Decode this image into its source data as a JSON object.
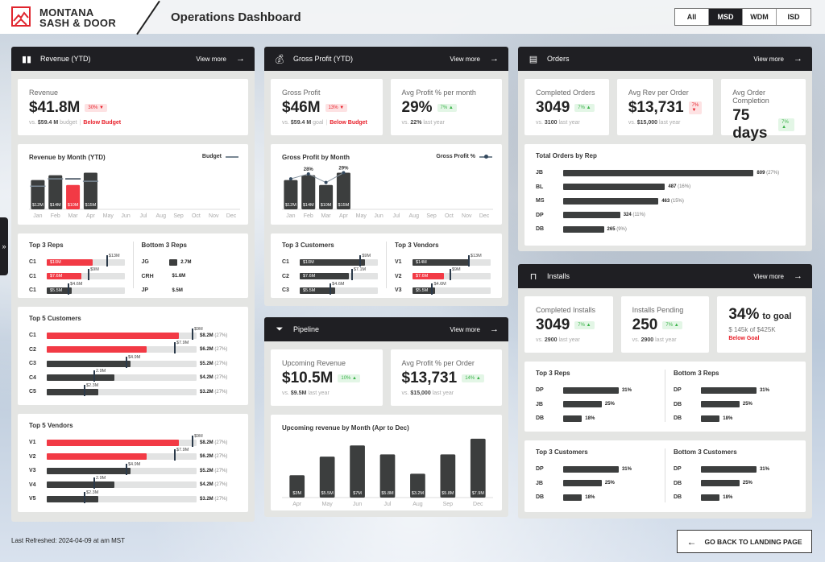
{
  "header": {
    "brand_line1": "MONTANA",
    "brand_line2": "SASH & DOOR",
    "title": "Operations Dashboard",
    "filters": [
      {
        "label": "All",
        "active": false
      },
      {
        "label": "MSD",
        "active": true
      },
      {
        "label": "WDM",
        "active": false
      },
      {
        "label": "ISD",
        "active": false
      }
    ]
  },
  "colors": {
    "accent": "#f23a45",
    "bar": "#3c3e3e",
    "panel_header": "#1f1f23",
    "up": "#3cb44b",
    "down": "#e8202a",
    "target": "#2b3a4a"
  },
  "revenue": {
    "title": "Revenue (YTD)",
    "view_more": "View more",
    "kpi": {
      "label": "Revenue",
      "value": "$41.8M",
      "delta": "30%",
      "dir": "down",
      "vs_prefix": "vs.",
      "vs_value": "$59.4 M",
      "vs_suffix": "budget",
      "status": "Below Budget"
    },
    "chart": {
      "title": "Revenue by Month (YTD)",
      "legend": "Budget",
      "type": "bar",
      "categories": [
        "Jan",
        "Feb",
        "Mar",
        "Apr",
        "May",
        "Jun",
        "Jul",
        "Aug",
        "Sep",
        "Oct",
        "Nov",
        "Dec"
      ],
      "values": [
        12,
        14,
        10,
        15
      ],
      "value_labels": [
        "$12M",
        "$14M",
        "$10M",
        "$15M"
      ],
      "budget": [
        9.5,
        12.5,
        12.5,
        11.5
      ],
      "highlight": [
        false,
        false,
        true,
        false
      ],
      "ylim": [
        0,
        16.5
      ]
    },
    "top_reps": {
      "title": "Top 3 Reps",
      "max": 17,
      "rows": [
        {
          "label": "C1",
          "value": 10,
          "value_label": "$10M",
          "target": 13,
          "target_label": "$13M",
          "highlight": true
        },
        {
          "label": "C1",
          "value": 7.6,
          "value_label": "$7.6M",
          "target": 9,
          "target_label": "$9M",
          "highlight": true
        },
        {
          "label": "C1",
          "value": 5.5,
          "value_label": "$5.5M",
          "target": 4.6,
          "target_label": "$4.6M",
          "highlight": false
        }
      ]
    },
    "bottom_reps": {
      "title": "Bottom 3 Reps",
      "max": 4.5,
      "rows": [
        {
          "label": "JG",
          "value": 2.7,
          "value_label": "2.7M"
        },
        {
          "label": "CRH",
          "value": 1.6,
          "value_label": "$1.6M"
        },
        {
          "label": "JP",
          "value": 0.5,
          "value_label": "$.5M"
        }
      ]
    },
    "top_customers": {
      "title": "Top 5 Customers",
      "max": 9.3,
      "rows": [
        {
          "label": "C1",
          "value": 8.2,
          "target": 9,
          "target_label": "$9M",
          "highlight": true,
          "total": "$8.2M",
          "pct": "(27%)"
        },
        {
          "label": "C2",
          "value": 6.2,
          "target": 7.9,
          "target_label": "$7.9M",
          "highlight": true,
          "total": "$6.2M",
          "pct": "(27%)"
        },
        {
          "label": "C3",
          "value": 5.2,
          "target": 4.9,
          "target_label": "$4.9M",
          "highlight": false,
          "total": "$5.2M",
          "pct": "(27%)"
        },
        {
          "label": "C4",
          "value": 4.2,
          "target": 2.9,
          "target_label": "2.9M",
          "highlight": false,
          "total": "$4.2M",
          "pct": "(27%)"
        },
        {
          "label": "C5",
          "value": 3.2,
          "target": 2.3,
          "target_label": "$2.3M",
          "highlight": false,
          "total": "$3.2M",
          "pct": "(27%)"
        }
      ]
    },
    "top_vendors": {
      "title": "Top 5 Vendors",
      "max": 9.3,
      "rows": [
        {
          "label": "V1",
          "value": 8.2,
          "target": 9,
          "target_label": "$9M",
          "highlight": true,
          "total": "$8.2M",
          "pct": "(27%)"
        },
        {
          "label": "V2",
          "value": 6.2,
          "target": 7.9,
          "target_label": "$7.9M",
          "highlight": true,
          "total": "$6.2M",
          "pct": "(27%)"
        },
        {
          "label": "V3",
          "value": 5.2,
          "target": 4.9,
          "target_label": "$4.9M",
          "highlight": false,
          "total": "$5.2M",
          "pct": "(27%)"
        },
        {
          "label": "V4",
          "value": 4.2,
          "target": 2.9,
          "target_label": "2.9M",
          "highlight": false,
          "total": "$4.2M",
          "pct": "(27%)"
        },
        {
          "label": "V5",
          "value": 3.2,
          "target": 2.3,
          "target_label": "$2.3M",
          "highlight": false,
          "total": "$3.2M",
          "pct": "(27%)"
        }
      ]
    }
  },
  "gross_profit": {
    "title": "Gross Profit (YTD)",
    "view_more": "View more",
    "kpi": {
      "label": "Gross Profit",
      "value": "$46M",
      "delta": "13%",
      "dir": "down",
      "vs_prefix": "vs.",
      "vs_value": "$59.4 M",
      "vs_suffix": "goal",
      "status": "Below Budget"
    },
    "kpi2": {
      "label": "Avg Profit % per month",
      "value": "29%",
      "delta": "7%",
      "dir": "up",
      "vs_prefix": "vs.",
      "vs_value": "22%",
      "vs_suffix": "last year"
    },
    "chart": {
      "title": "Gross Profit by Month",
      "legend": "Gross Profit %",
      "type": "bar",
      "categories": [
        "Jan",
        "Feb",
        "Mar",
        "Apr",
        "May",
        "Jun",
        "Jul",
        "Aug",
        "Sep",
        "Oct",
        "Nov",
        "Dec"
      ],
      "values": [
        12,
        14,
        10,
        15
      ],
      "value_labels": [
        "$12M",
        "$14M",
        "$10M",
        "$15M"
      ],
      "highlight": [
        false,
        false,
        false,
        false
      ],
      "line": [
        12.5,
        14.5,
        11,
        15
      ],
      "line_labels": [
        "",
        "28%",
        "",
        "29%"
      ],
      "ylim": [
        0,
        16.5
      ]
    },
    "top_customers": {
      "title": "Top 3 Customers",
      "max": 12,
      "rows": [
        {
          "label": "C1",
          "value": 10,
          "value_label": "$10M",
          "target": 9.2,
          "target_label": "$9M",
          "highlight": false
        },
        {
          "label": "C2",
          "value": 7.6,
          "value_label": "$7.6M",
          "target": 7.9,
          "target_label": "$7.1M",
          "highlight": false
        },
        {
          "label": "C3",
          "value": 5.5,
          "value_label": "$5.5M",
          "target": 4.6,
          "target_label": "$4.6M",
          "highlight": false
        }
      ]
    },
    "top_vendors": {
      "title": "Top 3 Vendors",
      "max": 19,
      "rows": [
        {
          "label": "V1",
          "value": 14,
          "value_label": "$14M",
          "target": 13.5,
          "target_label": "$13M",
          "highlight": false
        },
        {
          "label": "V2",
          "value": 7.6,
          "value_label": "$7.6M",
          "target": 9,
          "target_label": "$9M",
          "highlight": true
        },
        {
          "label": "V3",
          "value": 5.5,
          "value_label": "$5.5M",
          "target": 4.6,
          "target_label": "$4.6M",
          "highlight": false
        }
      ]
    }
  },
  "pipeline": {
    "title": "Pipeline",
    "view_more": "View more",
    "kpi": {
      "label": "Upcoming Revenue",
      "value": "$10.5M",
      "delta": "10%",
      "dir": "up",
      "vs_prefix": "vs.",
      "vs_value": "$9.5M",
      "vs_suffix": "last year"
    },
    "kpi2": {
      "label": "Avg Profit % per Order",
      "value": "$13,731",
      "delta": "14%",
      "dir": "up",
      "vs_prefix": "vs.",
      "vs_value": "$15,000",
      "vs_suffix": "last year"
    },
    "chart": {
      "title": "Upcoming revenue by Month (Apr to Dec)",
      "type": "bar",
      "categories": [
        "Apr",
        "May",
        "Jun",
        "Jul",
        "Aug",
        "Sep",
        "Dec"
      ],
      "values": [
        3,
        5.5,
        7,
        5.8,
        3.2,
        5.8,
        7.9
      ],
      "value_labels": [
        "$3M",
        "$5.5M",
        "$7M",
        "$5.8M",
        "$3.2M",
        "$5.8M",
        "$7.9M"
      ],
      "highlight": [
        false,
        false,
        false,
        false,
        false,
        false,
        false
      ],
      "ylim": [
        0,
        8
      ]
    }
  },
  "orders": {
    "title": "Orders",
    "view_more": "View more",
    "kpis": [
      {
        "label": "Completed Orders",
        "value": "3049",
        "delta": "7%",
        "dir": "up",
        "vs_prefix": "vs.",
        "vs_value": "3100",
        "vs_suffix": "last year"
      },
      {
        "label": "Avg Rev per Order",
        "value": "$13,731",
        "delta": "7%",
        "dir": "down",
        "vs_prefix": "vs.",
        "vs_value": "$15,000",
        "vs_suffix": "last year"
      },
      {
        "label": "Avg Order Completion",
        "value": "75 days",
        "delta": "7%",
        "dir": "up",
        "vs_prefix": "vs.",
        "vs_value": "63 days",
        "vs_suffix": "last year"
      }
    ],
    "by_rep": {
      "title": "Total Orders by Rep",
      "max": 840,
      "rows": [
        {
          "label": "JB",
          "value": 809,
          "value_label": "809",
          "pct": "(27%)"
        },
        {
          "label": "BL",
          "value": 487,
          "value_label": "487",
          "pct": "(16%)"
        },
        {
          "label": "MS",
          "value": 463,
          "value_label": "463",
          "pct": "(15%)"
        },
        {
          "label": "DP",
          "value": 324,
          "value_label": "324",
          "pct": "(11%)"
        },
        {
          "label": "DB",
          "value": 265,
          "value_label": "265",
          "pct": "(9%)"
        }
      ]
    }
  },
  "installs": {
    "title": "Installs",
    "view_more": "View more",
    "kpis": [
      {
        "label": "Completed Installs",
        "value": "3049",
        "delta": "7%",
        "dir": "up",
        "vs_prefix": "vs.",
        "vs_value": "2900",
        "vs_suffix": "last year"
      },
      {
        "label": "Installs Pending",
        "value": "250",
        "delta": "7%",
        "dir": "up",
        "vs_prefix": "vs.",
        "vs_value": "2900",
        "vs_suffix": "last year"
      }
    ],
    "goal": {
      "value": "34%",
      "suffix": "to goal",
      "detail": "$ 145k of $425K",
      "status": "Below Goal"
    },
    "top_reps": {
      "title": "Top 3 Reps",
      "max": 33,
      "rows": [
        {
          "label": "DP",
          "value": 31,
          "value_label": "31%"
        },
        {
          "label": "JB",
          "value": 25,
          "value_label": "25%"
        },
        {
          "label": "DB",
          "value": 18,
          "value_label": "18%"
        }
      ]
    },
    "bottom_reps": {
      "title": "Bottom 3 Reps",
      "max": 33,
      "rows": [
        {
          "label": "DP",
          "value": 31,
          "value_label": "31%"
        },
        {
          "label": "DB",
          "value": 25,
          "value_label": "25%"
        },
        {
          "label": "DB",
          "value": 18,
          "value_label": "18%"
        }
      ]
    },
    "top_customers": {
      "title": "Top 3 Customers",
      "max": 33,
      "rows": [
        {
          "label": "DP",
          "value": 31,
          "value_label": "31%"
        },
        {
          "label": "JB",
          "value": 25,
          "value_label": "25%"
        },
        {
          "label": "DB",
          "value": 18,
          "value_label": "18%"
        }
      ]
    },
    "bottom_customers": {
      "title": "Bottom 3 Customers",
      "max": 33,
      "rows": [
        {
          "label": "DP",
          "value": 31,
          "value_label": "31%"
        },
        {
          "label": "DB",
          "value": 25,
          "value_label": "25%"
        },
        {
          "label": "DB",
          "value": 18,
          "value_label": "18%"
        }
      ]
    }
  },
  "footer": {
    "last_refreshed": "Last Refreshed: 2024-04-09 at am MST",
    "back_button": "GO BACK TO LANDING PAGE"
  }
}
